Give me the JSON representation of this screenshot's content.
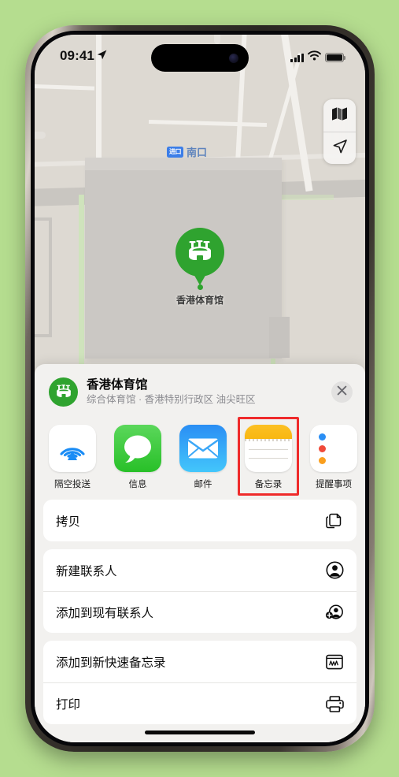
{
  "status_bar": {
    "time": "09:41",
    "location_arrow": "location-arrow-icon",
    "signal": "cellular-signal-icon",
    "wifi": "wifi-icon",
    "battery": "battery-icon"
  },
  "map": {
    "pin_label": "香港体育馆",
    "pin_icon": "stadium-icon",
    "metro_badge": "进口",
    "metro_label": "南口",
    "controls": [
      {
        "name": "map-layers-button",
        "icon": "folded-map-icon"
      },
      {
        "name": "locate-me-button",
        "icon": "navigation-arrow-icon"
      }
    ]
  },
  "share_sheet": {
    "title": "香港体育馆",
    "subtitle": "综合体育馆 · 香港特别行政区 油尖旺区",
    "icon": "stadium-icon",
    "close_label": "✕",
    "apps": [
      {
        "label": "隔空投送",
        "icon": "airdrop-icon",
        "selected": false
      },
      {
        "label": "信息",
        "icon": "messages-icon",
        "selected": false
      },
      {
        "label": "邮件",
        "icon": "mail-icon",
        "selected": false
      },
      {
        "label": "备忘录",
        "icon": "notes-icon",
        "selected": true
      },
      {
        "label": "提醒事项",
        "icon": "reminders-icon",
        "selected": false
      }
    ],
    "actions": [
      {
        "label": "拷贝",
        "icon": "copy-icon"
      },
      {
        "label": "新建联系人",
        "icon": "new-contact-icon"
      },
      {
        "label": "添加到现有联系人",
        "icon": "add-to-contact-icon"
      },
      {
        "label": "添加到新快速备忘录",
        "icon": "quick-note-icon"
      },
      {
        "label": "打印",
        "icon": "printer-icon"
      }
    ]
  },
  "colors": {
    "background": "#b5dd8f",
    "accent_green": "#2fa32f",
    "highlight_red": "#ef2b2b",
    "transit_blue": "#3c7ee8"
  }
}
